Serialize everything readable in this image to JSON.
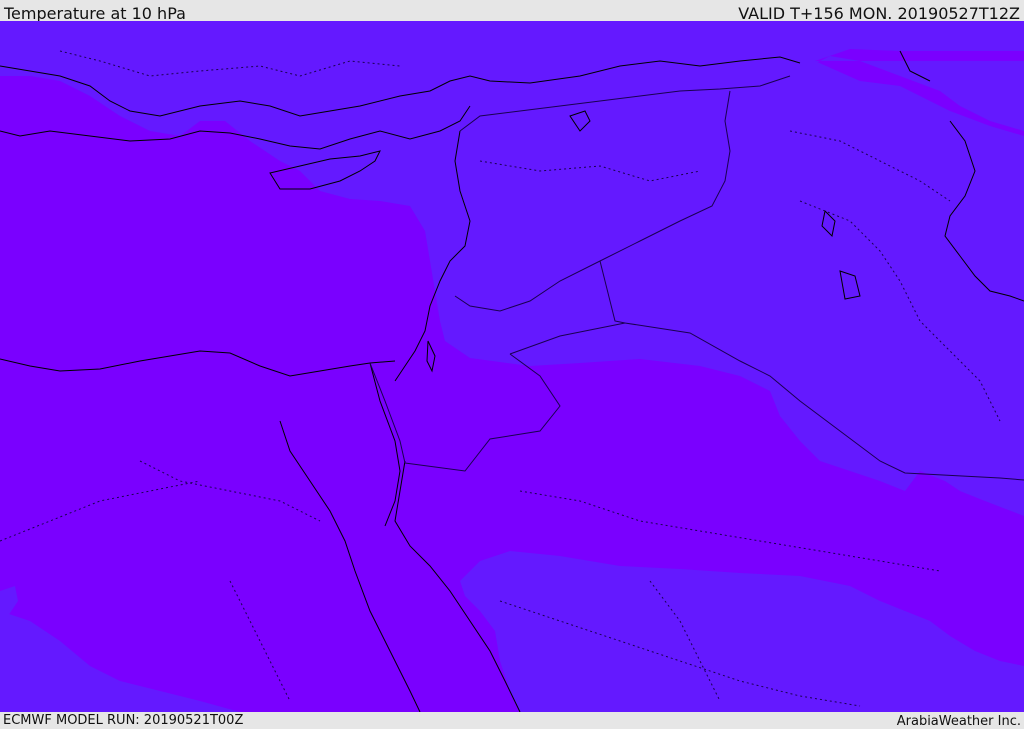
{
  "header": {
    "title": "Temperature at 10 hPa",
    "valid_time": "VALID T+156 MON. 20190527T12Z"
  },
  "footer": {
    "model_run": "ECMWF MODEL RUN: 20190521T00Z",
    "credit": "ArabiaWeather Inc."
  },
  "map": {
    "field": "Temperature",
    "level": "10 hPa",
    "colors": {
      "warm_band": "#7a00ff",
      "cool_band": "#6419ff",
      "coastline": "#000000",
      "border": "#1a0050"
    }
  }
}
